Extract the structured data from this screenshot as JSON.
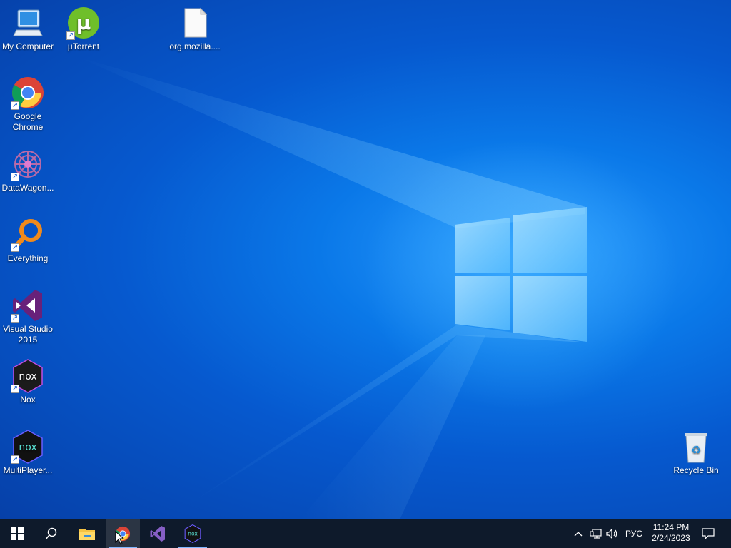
{
  "desktop": {
    "icons": [
      {
        "label": "My Computer",
        "icon": "computer-icon"
      },
      {
        "label": "µTorrent",
        "icon": "utorrent-icon"
      },
      {
        "label": "org.mozilla....",
        "icon": "file-icon"
      },
      {
        "label": "Google Chrome",
        "icon": "chrome-icon"
      },
      {
        "label": "DataWagon...",
        "icon": "datawagon-icon"
      },
      {
        "label": "Everything",
        "icon": "everything-search-icon"
      },
      {
        "label": "Visual Studio 2015",
        "icon": "visual-studio-icon"
      },
      {
        "label": "Nox",
        "icon": "nox-icon"
      },
      {
        "label": "MultiPlayer...",
        "icon": "nox-multiplayer-icon"
      },
      {
        "label": "Recycle Bin",
        "icon": "recycle-bin-icon"
      }
    ]
  },
  "taskbar": {
    "buttons": [
      {
        "name": "start-button",
        "icon": "windows-logo-icon"
      },
      {
        "name": "search-button",
        "icon": "search-icon"
      },
      {
        "name": "file-explorer",
        "icon": "folder-icon"
      },
      {
        "name": "chrome",
        "icon": "chrome-icon"
      },
      {
        "name": "visual-studio",
        "icon": "visual-studio-icon"
      },
      {
        "name": "nox",
        "icon": "nox-icon"
      }
    ],
    "tray": {
      "language": "РУС",
      "time": "11:24 PM",
      "date": "2/24/2023"
    }
  },
  "colors": {
    "taskbar": "#0e1a2b",
    "desktop_blue": "#0a78e8",
    "windows_logo_glow": "#8fd3ff"
  }
}
